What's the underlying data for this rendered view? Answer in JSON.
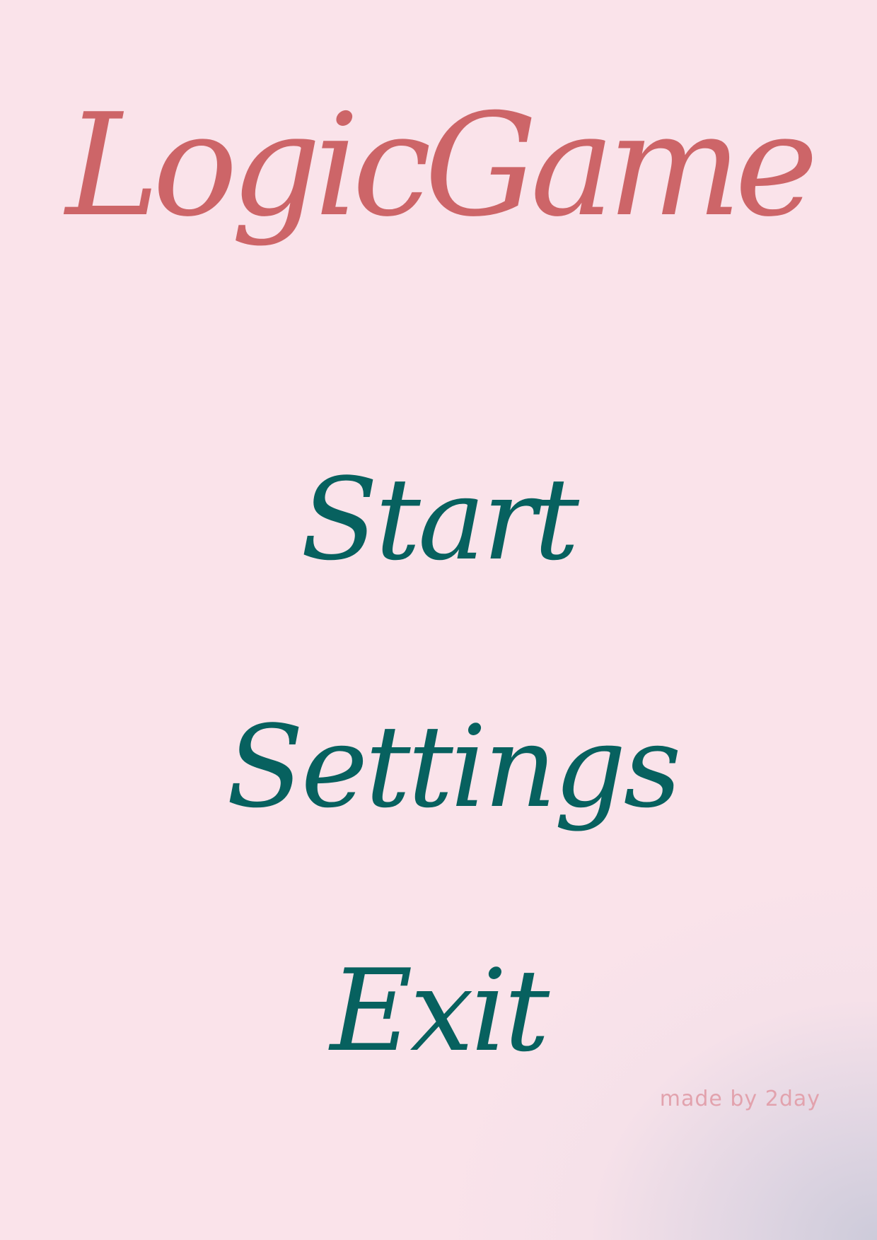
{
  "title": "LogicGame",
  "menu": {
    "start_label": "Start",
    "settings_label": "Settings",
    "exit_label": "Exit"
  },
  "credit": "made by 2day",
  "colors": {
    "background": "#fae3ea",
    "title": "#cd6568",
    "menu_text": "#07615f",
    "credit": "#e2a2ad",
    "corner_shade": "#cdcbda"
  }
}
